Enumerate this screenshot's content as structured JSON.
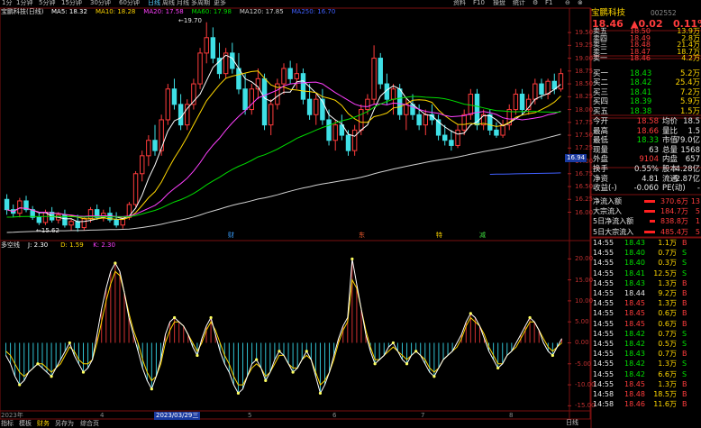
{
  "toolbar": {
    "items": [
      "1分",
      "1分钟",
      "5分钟",
      "15分钟",
      "30分钟",
      "60分钟",
      "日线",
      "周线",
      "月线",
      "多周期",
      "更多"
    ],
    "active_index": 6,
    "right_items": [
      "资料",
      "F10",
      "操盘",
      "统计",
      "⚙",
      "F1",
      "⊖",
      "⊗"
    ]
  },
  "stock": {
    "name": "宝鹏科技",
    "code": "002552",
    "last": "18.46",
    "change": "▲0.02",
    "pct": "0.11%"
  },
  "ma_legend": {
    "name": "宝鹏科技(日线)",
    "items": [
      {
        "label": "MA5: 18.32",
        "color": "#ffffff"
      },
      {
        "label": "MA10: 18.28",
        "color": "#ffd700"
      },
      {
        "label": "MA20: 17.58",
        "color": "#ff40ff"
      },
      {
        "label": "MA60: 17.98",
        "color": "#00dd00"
      },
      {
        "label": "MA120: 17.85",
        "color": "#d0d0d0"
      },
      {
        "label": "MA250: 16.70",
        "color": "#4060ff"
      }
    ]
  },
  "kdj_legend": {
    "name": "多空线",
    "items": [
      {
        "label": "J: 2.30",
        "color": "#ffffff"
      },
      {
        "label": "D: 1.59",
        "color": "#ffd700"
      },
      {
        "label": "K: 2.30",
        "color": "#ff40ff"
      }
    ]
  },
  "price_axis": [
    "18.75",
    "18.50",
    "18.25",
    "18.00",
    "17.75",
    "17.50",
    "17.25",
    "17.00",
    "16.75",
    "16.50",
    "16.25",
    "16.00"
  ],
  "price_axis_top": "19.50",
  "price_axis_labels_extra": [
    "19.25",
    "19.00"
  ],
  "current_price_tag": "16.94",
  "kdj_axis": [
    "20.00",
    "15.00",
    "10.00",
    "5.00",
    "0.00",
    "-5.00",
    "-10.00",
    "-15.00"
  ],
  "annotations": {
    "high": "19.70",
    "low": "15.62",
    "events": [
      {
        "text": "财",
        "color": "#3aa0ff"
      },
      {
        "text": "东",
        "color": "#ff6030"
      },
      {
        "text": "特",
        "color": "#ffd700"
      },
      {
        "text": "减",
        "color": "#40e040"
      }
    ]
  },
  "date_axis": {
    "left": "2023年",
    "highlight": "2023/03/29三",
    "ticks": [
      "4",
      "5",
      "6",
      "7",
      "8"
    ]
  },
  "order_book": {
    "asks": [
      {
        "label": "卖五",
        "price": "18.50",
        "vol": "13.9万"
      },
      {
        "label": "卖四",
        "price": "18.49",
        "vol": "2.8万"
      },
      {
        "label": "卖三",
        "price": "18.48",
        "vol": "21.4万"
      },
      {
        "label": "卖二",
        "price": "18.47",
        "vol": "18.7万"
      },
      {
        "label": "卖一",
        "price": "18.46",
        "vol": "4.2万"
      }
    ],
    "bids": [
      {
        "label": "买一",
        "price": "18.43",
        "vol": "5.2万"
      },
      {
        "label": "买二",
        "price": "18.42",
        "vol": "25.4万"
      },
      {
        "label": "买三",
        "price": "18.41",
        "vol": "7.2万"
      },
      {
        "label": "买四",
        "price": "18.39",
        "vol": "5.9万"
      },
      {
        "label": "买五",
        "price": "18.38",
        "vol": "1.5万"
      }
    ]
  },
  "stats": [
    {
      "l1": "今开",
      "v1": "18.58",
      "c1": "red",
      "l2": "均价",
      "v2": "18.5"
    },
    {
      "l1": "最高",
      "v1": "18.66",
      "c1": "red",
      "l2": "量比",
      "v2": "1.5"
    },
    {
      "l1": "最低",
      "v1": "18.33",
      "c1": "grn",
      "l2": "市值",
      "v2": "79.0亿"
    },
    {
      "l1": "现量",
      "v1": "63",
      "c1": "wht",
      "l2": "总量",
      "v2": "1568"
    },
    {
      "l1": "外盘",
      "v1": "9104",
      "c1": "red",
      "l2": "内盘",
      "v2": "657"
    },
    {
      "l1": "换手",
      "v1": "0.55%",
      "c1": "wht",
      "l2": "股本",
      "v2": "4.28亿"
    },
    {
      "l1": "净资",
      "v1": "4.81",
      "c1": "wht",
      "l2": "流通",
      "v2": "2.87亿"
    },
    {
      "l1": "收益(-)",
      "v1": "-0.060",
      "c1": "wht",
      "l2": "PE(动)",
      "v2": "-"
    }
  ],
  "flows": [
    {
      "label": "净流入额",
      "value": "370.6万",
      "extra": "13"
    },
    {
      "label": "大宗流入",
      "value": "184.7万",
      "extra": "5"
    },
    {
      "label": "5日净流入额",
      "value": "838.8万",
      "extra": "1"
    },
    {
      "label": "5日大宗流入",
      "value": "485.4万",
      "extra": "5"
    }
  ],
  "ticks": [
    {
      "time": "14:55",
      "price": "18.43",
      "vol": "1.1万",
      "side": "B"
    },
    {
      "time": "14:55",
      "price": "18.40",
      "vol": "0.7万",
      "side": "S"
    },
    {
      "time": "14:55",
      "price": "18.40",
      "vol": "0.3万",
      "side": "S"
    },
    {
      "time": "14:55",
      "price": "18.41",
      "vol": "12.5万",
      "side": "S"
    },
    {
      "time": "14:55",
      "price": "18.43",
      "vol": "1.3万",
      "side": "B"
    },
    {
      "time": "14:55",
      "price": "18.44",
      "vol": "9.2万",
      "side": "B"
    },
    {
      "time": "14:55",
      "price": "18.45",
      "vol": "1.3万",
      "side": "B"
    },
    {
      "time": "14:55",
      "price": "18.45",
      "vol": "0.6万",
      "side": "B"
    },
    {
      "time": "14:55",
      "price": "18.45",
      "vol": "0.6万",
      "side": "B"
    },
    {
      "time": "14:55",
      "price": "18.42",
      "vol": "0.7万",
      "side": "S"
    },
    {
      "time": "14:55",
      "price": "18.42",
      "vol": "0.5万",
      "side": "S"
    },
    {
      "time": "14:55",
      "price": "18.43",
      "vol": "0.7万",
      "side": "B"
    },
    {
      "time": "14:55",
      "price": "18.42",
      "vol": "1.3万",
      "side": "S"
    },
    {
      "time": "14:55",
      "price": "18.42",
      "vol": "6.6万",
      "side": "S"
    },
    {
      "time": "14:55",
      "price": "18.45",
      "vol": "1.3万",
      "side": "B"
    },
    {
      "time": "14:58",
      "price": "18.48",
      "vol": "18.5万",
      "side": "B"
    },
    {
      "time": "14:58",
      "price": "18.46",
      "vol": "11.6万",
      "side": "B"
    }
  ],
  "bottom_tabs": [
    "指标",
    "模板",
    "财务",
    "另存为",
    "综合页"
  ],
  "bottom_active": 2,
  "bottom_right": "日线",
  "colors": {
    "up": "#ff3c3c",
    "down": "#3fe0e6",
    "grid": "#7a1010",
    "ma5": "#ffffff",
    "ma10": "#ffd700",
    "ma20": "#ff40ff",
    "ma60": "#00dd00",
    "ma120": "#d0d0d0",
    "ma250": "#4060ff"
  },
  "chart_data": {
    "type": "candlestick",
    "ylim": [
      15.5,
      19.8
    ],
    "candles": [
      [
        16.25,
        16.35,
        15.95,
        16.05
      ],
      [
        16.05,
        16.15,
        15.9,
        15.98
      ],
      [
        15.98,
        16.28,
        15.9,
        16.22
      ],
      [
        16.22,
        16.32,
        16.0,
        16.05
      ],
      [
        16.05,
        16.12,
        15.85,
        15.9
      ],
      [
        15.9,
        16.0,
        15.75,
        15.8
      ],
      [
        15.8,
        16.05,
        15.75,
        16.0
      ],
      [
        16.0,
        16.1,
        15.8,
        15.85
      ],
      [
        15.85,
        16.0,
        15.78,
        15.95
      ],
      [
        15.95,
        16.05,
        15.7,
        15.75
      ],
      [
        15.75,
        15.88,
        15.65,
        15.82
      ],
      [
        15.82,
        15.95,
        15.62,
        15.7
      ],
      [
        15.7,
        15.9,
        15.65,
        15.88
      ],
      [
        15.88,
        16.1,
        15.8,
        16.05
      ],
      [
        16.05,
        16.15,
        15.85,
        15.9
      ],
      [
        15.9,
        16.05,
        15.82,
        15.98
      ],
      [
        15.98,
        16.1,
        15.8,
        15.85
      ],
      [
        15.85,
        16.0,
        15.7,
        15.75
      ],
      [
        15.75,
        15.92,
        15.68,
        15.9
      ],
      [
        15.9,
        16.2,
        15.85,
        16.15
      ],
      [
        16.15,
        16.8,
        16.1,
        16.75
      ],
      [
        16.75,
        17.2,
        16.6,
        17.1
      ],
      [
        17.1,
        17.5,
        16.9,
        17.4
      ],
      [
        17.4,
        17.7,
        17.1,
        17.2
      ],
      [
        17.2,
        17.9,
        17.1,
        17.8
      ],
      [
        17.8,
        18.5,
        17.7,
        18.4
      ],
      [
        18.4,
        18.6,
        18.0,
        18.1
      ],
      [
        18.1,
        18.3,
        17.6,
        17.7
      ],
      [
        17.7,
        18.2,
        17.6,
        18.1
      ],
      [
        18.1,
        18.6,
        18.0,
        18.5
      ],
      [
        18.5,
        19.2,
        18.4,
        19.1
      ],
      [
        19.1,
        19.7,
        18.9,
        19.4
      ],
      [
        19.4,
        19.6,
        18.9,
        19.0
      ],
      [
        19.0,
        19.3,
        18.6,
        18.7
      ],
      [
        18.7,
        19.2,
        18.6,
        19.1
      ],
      [
        19.1,
        19.3,
        18.7,
        18.8
      ],
      [
        18.8,
        19.1,
        18.3,
        18.4
      ],
      [
        18.4,
        18.7,
        17.9,
        18.0
      ],
      [
        18.0,
        18.5,
        17.9,
        18.4
      ],
      [
        18.4,
        18.8,
        18.2,
        18.6
      ],
      [
        18.6,
        18.7,
        17.6,
        17.7
      ],
      [
        17.7,
        18.2,
        17.5,
        18.1
      ],
      [
        18.1,
        18.6,
        18.0,
        18.5
      ],
      [
        18.5,
        18.9,
        18.3,
        18.8
      ],
      [
        18.8,
        18.95,
        18.5,
        18.6
      ],
      [
        18.6,
        18.9,
        18.4,
        18.7
      ],
      [
        18.7,
        18.8,
        18.1,
        18.2
      ],
      [
        18.2,
        18.5,
        17.8,
        17.9
      ],
      [
        17.9,
        18.3,
        17.7,
        18.2
      ],
      [
        18.2,
        18.4,
        17.7,
        17.8
      ],
      [
        17.8,
        18.0,
        17.3,
        17.4
      ],
      [
        17.4,
        17.8,
        17.2,
        17.7
      ],
      [
        17.7,
        17.9,
        17.4,
        17.5
      ],
      [
        17.5,
        17.6,
        17.1,
        17.2
      ],
      [
        17.2,
        17.7,
        17.1,
        17.6
      ],
      [
        17.6,
        18.1,
        17.5,
        18.0
      ],
      [
        18.0,
        18.3,
        17.9,
        18.2
      ],
      [
        18.2,
        19.25,
        18.1,
        19.0
      ],
      [
        19.0,
        19.1,
        18.4,
        18.5
      ],
      [
        18.5,
        18.7,
        18.1,
        18.2
      ],
      [
        18.2,
        18.5,
        17.9,
        18.4
      ],
      [
        18.4,
        18.5,
        17.8,
        17.9
      ],
      [
        17.9,
        18.2,
        17.6,
        18.1
      ],
      [
        18.1,
        18.3,
        17.8,
        17.9
      ],
      [
        17.9,
        18.1,
        17.6,
        17.7
      ],
      [
        17.7,
        18.0,
        17.5,
        17.9
      ],
      [
        17.9,
        18.1,
        17.7,
        17.8
      ],
      [
        17.8,
        17.9,
        17.4,
        17.5
      ],
      [
        17.5,
        17.7,
        17.3,
        17.4
      ],
      [
        17.4,
        17.6,
        17.2,
        17.3
      ],
      [
        17.3,
        17.7,
        17.25,
        17.6
      ],
      [
        17.6,
        18.0,
        17.5,
        17.9
      ],
      [
        17.9,
        18.4,
        17.8,
        18.3
      ],
      [
        18.3,
        18.4,
        17.6,
        17.7
      ],
      [
        17.7,
        18.0,
        17.6,
        17.9
      ],
      [
        17.9,
        18.0,
        17.5,
        17.6
      ],
      [
        17.6,
        17.75,
        17.45,
        17.5
      ],
      [
        17.5,
        17.8,
        17.45,
        17.7
      ],
      [
        17.7,
        18.1,
        17.6,
        18.0
      ],
      [
        18.0,
        18.4,
        17.9,
        18.3
      ],
      [
        18.3,
        18.4,
        17.9,
        18.0
      ],
      [
        18.0,
        18.3,
        17.9,
        18.2
      ],
      [
        18.2,
        18.6,
        18.1,
        18.5
      ],
      [
        18.5,
        18.6,
        18.2,
        18.3
      ],
      [
        18.3,
        18.6,
        18.2,
        18.55
      ],
      [
        18.55,
        18.7,
        18.3,
        18.4
      ],
      [
        18.4,
        18.8,
        18.35,
        18.7
      ]
    ],
    "kdj_series": {
      "J": [
        -3,
        -5,
        -8,
        -10,
        -9,
        -7,
        -6,
        -5,
        -6,
        -7,
        -8,
        -6,
        -4,
        -2,
        0,
        -3,
        -5,
        -7,
        -6,
        -4,
        2,
        8,
        13,
        17,
        19,
        17,
        12,
        6,
        2,
        -2,
        -6,
        -9,
        -11,
        -8,
        -4,
        2,
        5,
        6,
        5,
        4,
        2,
        -1,
        -3,
        1,
        4,
        6,
        2,
        -2,
        -5,
        -7,
        -10,
        -12,
        -11,
        -8,
        -5,
        -4,
        -6,
        -9,
        -7,
        -4,
        -2,
        -3,
        -5,
        -7,
        -6,
        -4,
        -2,
        -4,
        -8,
        -12,
        -10,
        -7,
        -3,
        1,
        4,
        6,
        20,
        14,
        8,
        2,
        -2,
        -5,
        -4,
        -3,
        -1,
        0,
        -2,
        -4,
        -5,
        -3,
        -2,
        -3,
        -5,
        -7,
        -8,
        -6,
        -4,
        -3,
        -2,
        0,
        2,
        5,
        7,
        6,
        4,
        1,
        -2,
        -4,
        -6,
        -5,
        -3,
        -2,
        0,
        2,
        4,
        6,
        5,
        3,
        0,
        -2,
        -3,
        -1,
        1
      ],
      "D": [
        -2,
        -3,
        -5,
        -7,
        -8,
        -7,
        -6,
        -5,
        -5,
        -6,
        -7,
        -6,
        -5,
        -3,
        -1,
        -2,
        -4,
        -5,
        -5,
        -4,
        0,
        5,
        10,
        14,
        17,
        16,
        12,
        7,
        3,
        0,
        -4,
        -7,
        -9,
        -8,
        -5,
        0,
        3,
        5,
        5,
        4,
        2,
        0,
        -2,
        0,
        3,
        5,
        3,
        0,
        -3,
        -5,
        -8,
        -10,
        -10,
        -8,
        -6,
        -5,
        -6,
        -8,
        -7,
        -5,
        -3,
        -3,
        -5,
        -6,
        -6,
        -4,
        -3,
        -4,
        -7,
        -10,
        -9,
        -7,
        -4,
        0,
        3,
        5,
        15,
        13,
        8,
        3,
        -1,
        -4,
        -4,
        -3,
        -2,
        -1,
        -2,
        -3,
        -4,
        -3,
        -2,
        -3,
        -4,
        -6,
        -7,
        -6,
        -4,
        -3,
        -2,
        -1,
        1,
        4,
        6,
        5,
        4,
        2,
        -1,
        -3,
        -5,
        -5,
        -3,
        -2,
        -1,
        1,
        3,
        5,
        5,
        3,
        1,
        -1,
        -2,
        -1,
        0
      ]
    }
  }
}
